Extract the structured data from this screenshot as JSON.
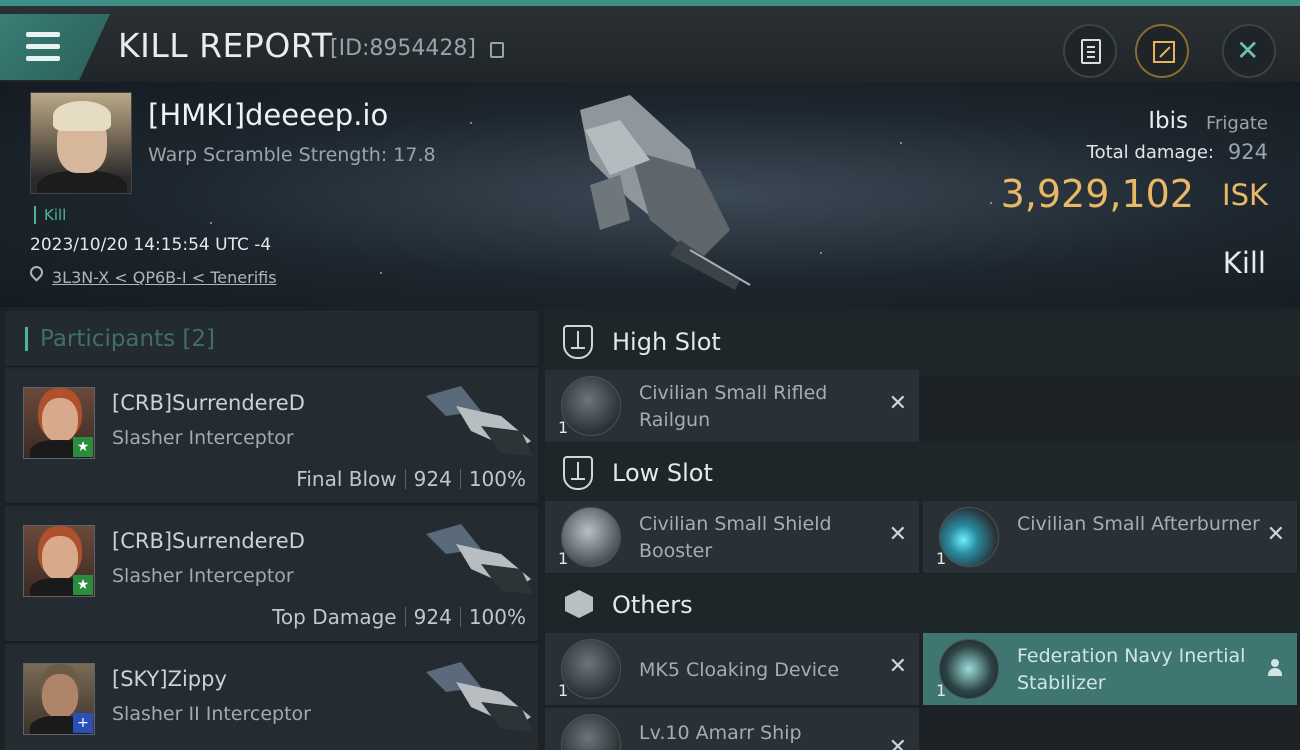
{
  "header": {
    "title": "KILL REPORT",
    "id_label": "[ID:8954428]",
    "icons": [
      "menu-icon",
      "copy-icon",
      "clipboard-icon",
      "share-icon",
      "close-icon"
    ]
  },
  "victim": {
    "name": "[HMKI]deeeep.io",
    "warp_scramble": "Warp Scramble Strength: 17.8",
    "tag": "Kill",
    "datetime": "2023/10/20 14:15:54 UTC -4",
    "location": "3L3N-X < QP6B-I < Tenerifis"
  },
  "loss": {
    "ship_name": "Ibis",
    "ship_class": "Frigate",
    "total_damage_label": "Total damage:",
    "total_damage_value": "924",
    "isk_value": "3,929,102",
    "isk_unit": "ISK",
    "result": "Kill"
  },
  "participants": {
    "title": "Participants",
    "count": "[2]",
    "rows": [
      {
        "name": "[CRB]SurrendereD",
        "ship": "Slasher Interceptor",
        "role": "Final Blow",
        "damage": "924",
        "percent": "100%",
        "badge": "★"
      },
      {
        "name": "[CRB]SurrendereD",
        "ship": "Slasher Interceptor",
        "role": "Top Damage",
        "damage": "924",
        "percent": "100%",
        "badge": "★"
      },
      {
        "name": "[SKY]Zippy",
        "ship": "Slasher II Interceptor",
        "badge": "+"
      }
    ]
  },
  "fitting": {
    "high_slot": {
      "title": "High Slot",
      "modules": [
        {
          "qty": "1",
          "name": "Civilian Small Rifled Railgun"
        }
      ]
    },
    "low_slot": {
      "title": "Low Slot",
      "modules": [
        {
          "qty": "1",
          "name": "Civilian Small Shield Booster"
        },
        {
          "qty": "1",
          "name": "Civilian Small Afterburner"
        }
      ]
    },
    "others": {
      "title": "Others",
      "modules": [
        {
          "qty": "1",
          "name": "MK5 Cloaking Device"
        },
        {
          "qty": "1",
          "name": "Federation Navy Inertial Stabilizer"
        },
        {
          "qty": "",
          "name": "Lv.10 Amarr Ship"
        }
      ]
    },
    "remove_symbol": "✕"
  },
  "colors": {
    "accent": "#3d8f86",
    "isk_gold": "#e9b864",
    "kill_tag": "#4fb39d",
    "active_module": "#3f7671"
  }
}
